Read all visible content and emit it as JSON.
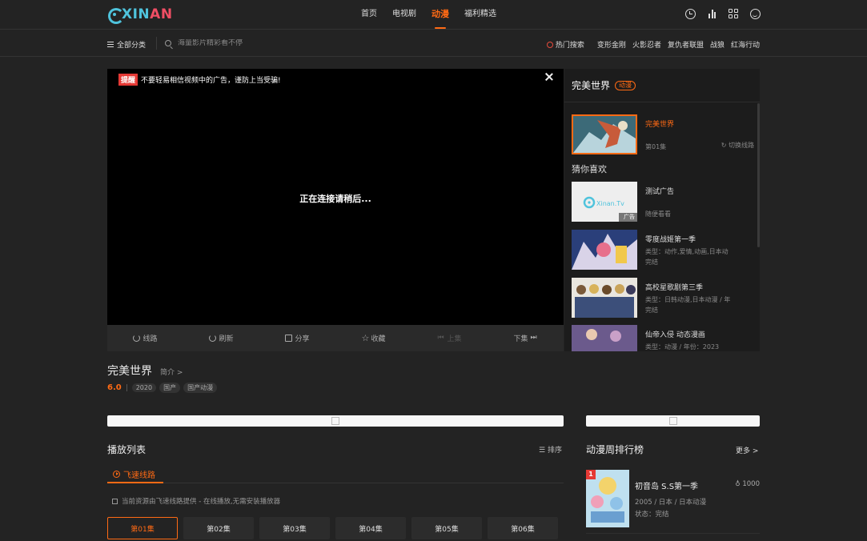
{
  "logo": {
    "part1": "XIN",
    "part2": "AN"
  },
  "nav": {
    "items": [
      "首页",
      "电视剧",
      "动漫",
      "福利精选"
    ],
    "active_index": 2
  },
  "subbar": {
    "category_label": "全部分类",
    "search_placeholder": "海量影片精彩看不停",
    "hot_title": "热门搜索",
    "hot_tags": [
      "变形金刚",
      "火影忍者",
      "复仇者联盟",
      "战狼",
      "红海行动"
    ]
  },
  "player": {
    "notice_badge": "提醒",
    "notice_text": "不要轻易相信视频中的广告，谨防上当受骗!",
    "status": "正在连接请稍后..."
  },
  "controls": {
    "route": "线路",
    "refresh": "刷新",
    "share": "分享",
    "favorite": "收藏",
    "prev": "上集",
    "next": "下集"
  },
  "side": {
    "title": "完美世界",
    "tag": "动漫",
    "current": {
      "title": "完美世界",
      "episode": "第01集",
      "switch": "切换线路"
    },
    "guess_label": "猜你喜欢",
    "recs": [
      {
        "title": "测试广告",
        "line1": "随便看看",
        "line2": "",
        "ad_mark": "广告"
      },
      {
        "title": "零度战姬第一季",
        "line1": "类型：动作,爱情,动画,日本动",
        "line2": "完结"
      },
      {
        "title": "高校星歌剧第三季",
        "line1": "类型：日韩动漫,日本动漫 / 年",
        "line2": "完结"
      },
      {
        "title": "仙帝入侵 动态漫画",
        "line1": "类型：动漫 / 年份：2023",
        "line2": ""
      }
    ],
    "ad_logo_text": "Xinan.Tv"
  },
  "info": {
    "title": "完美世界",
    "intro": "简介 >",
    "score": "6.0",
    "chips": [
      "2020",
      "国产",
      "国产动漫"
    ]
  },
  "playlist": {
    "title": "播放列表",
    "sort": "排序",
    "route_tab": "飞速线路",
    "note": "当前资源由飞速线路提供 - 在线播放,无需安装播放器",
    "episodes": [
      "第01集",
      "第02集",
      "第03集",
      "第04集",
      "第05集",
      "第06集"
    ],
    "active_index": 0
  },
  "ranking": {
    "title": "动漫周排行榜",
    "more": "更多 >",
    "items": [
      {
        "rank": "1",
        "name": "初音岛 S.S第一季",
        "heat": "1000",
        "meta": "2005 / 日本 / 日本动漫",
        "status": "状态：完结"
      }
    ]
  },
  "colors": {
    "accent": "#ff6a14",
    "logo_blue": "#4fc3dc",
    "logo_red": "#f04e64",
    "bg": "#232323"
  }
}
